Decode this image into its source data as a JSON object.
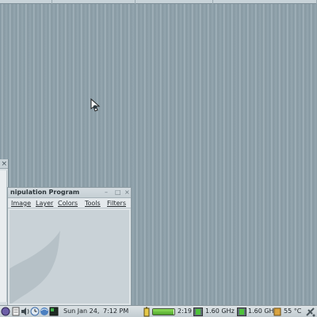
{
  "gimp_window": {
    "title": "nipulation Program",
    "menu": [
      "Image",
      "Layer",
      "Colors",
      "Tools",
      "Filters"
    ]
  },
  "left_window": {
    "close": "×"
  },
  "panel": {
    "date": "Sun Jan 24,",
    "time": "7:12 PM",
    "battery_time": "2:19",
    "battery_level": 0.95,
    "cpu1": "1.60 GHz",
    "cpu2": "1.60 GHz",
    "temperature": "55 °C"
  },
  "icons": [
    "start-menu-icon",
    "text-editor-icon",
    "terminal-icon",
    "volume-icon",
    "clock-icon",
    "browser-icon",
    "workspace-icon",
    "battery-icon",
    "cpu-frequency-icon",
    "thermometer-icon",
    "network-icon"
  ],
  "colors": {
    "desktop": "#8a9ca5",
    "battery": "#4fa52e",
    "panel": "#c2ccd1"
  }
}
